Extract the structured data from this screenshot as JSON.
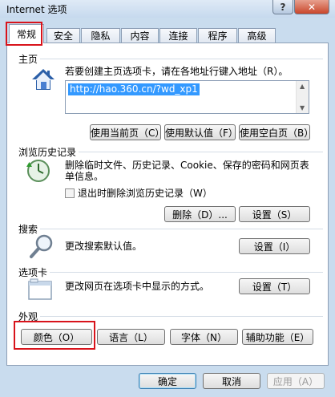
{
  "window": {
    "title": "Internet 选项",
    "help": "?",
    "close": "✕"
  },
  "tabs": [
    "常规",
    "安全",
    "隐私",
    "内容",
    "连接",
    "程序",
    "高级"
  ],
  "homepage": {
    "label": "主页",
    "description": "若要创建主页选项卡，请在各地址行键入地址（R）。",
    "url": "http://hao.360.cn/?wd_xp1",
    "buttons": [
      "使用当前页（C）",
      "使用默认值（F）",
      "使用空白页（B）"
    ]
  },
  "history": {
    "label": "浏览历史记录",
    "description": "删除临时文件、历史记录、Cookie、保存的密码和网页表单信息。",
    "checkbox": "退出时删除浏览历史记录（W）",
    "checked": false,
    "buttons": [
      "删除（D）...",
      "设置（S）"
    ]
  },
  "search": {
    "label": "搜索",
    "description": "更改搜索默认值。",
    "button": "设置（I）"
  },
  "tabsSection": {
    "label": "选项卡",
    "description": "更改网页在选项卡中显示的方式。",
    "button": "设置（T）"
  },
  "appearance": {
    "label": "外观",
    "buttons": [
      "颜色（O）",
      "语言（L）",
      "字体（N）",
      "辅助功能（E）"
    ]
  },
  "footer": {
    "ok": "确定",
    "cancel": "取消",
    "apply": "应用（A）"
  },
  "colors": {
    "highlight": "#d8131b",
    "accent": "#3399ff"
  }
}
